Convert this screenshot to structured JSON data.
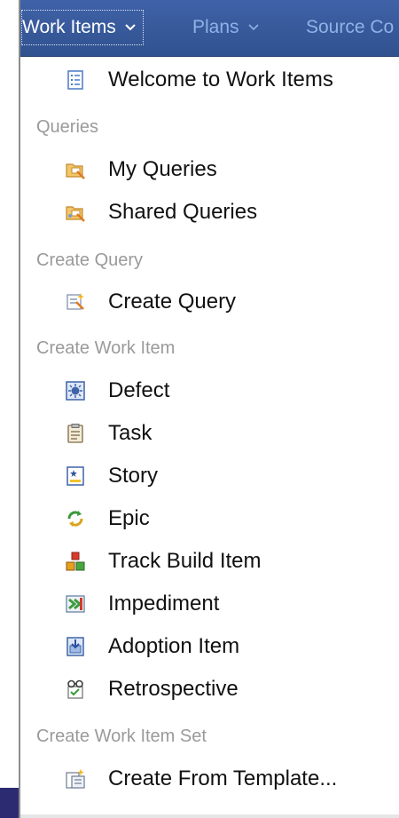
{
  "nav": {
    "tabs": [
      {
        "label": "Work Items",
        "active": true
      },
      {
        "label": "Plans",
        "active": false
      },
      {
        "label": "Source Co",
        "active": false
      }
    ]
  },
  "menu": {
    "welcome": "Welcome to Work Items",
    "sections": [
      {
        "title": "Queries",
        "items": [
          "My Queries",
          "Shared Queries"
        ]
      },
      {
        "title": "Create Query",
        "items": [
          "Create Query"
        ]
      },
      {
        "title": "Create Work Item",
        "items": [
          "Defect",
          "Task",
          "Story",
          "Epic",
          "Track Build Item",
          "Impediment",
          "Adoption Item",
          "Retrospective"
        ]
      },
      {
        "title": "Create Work Item Set",
        "items": [
          "Create From Template..."
        ]
      }
    ]
  },
  "colors": {
    "nav_bg": "#3a5b9e",
    "nav_inactive_text": "#8fb2e6",
    "section_text": "#9a9a9a",
    "item_text": "#111111"
  },
  "icons": {
    "welcome": "document-list-icon",
    "my_queries": "query-folder-icon",
    "shared_queries": "shared-query-folder-icon",
    "create_query": "create-query-icon",
    "defect": "defect-bug-icon",
    "task": "task-clipboard-icon",
    "story": "story-card-icon",
    "epic": "epic-cycle-icon",
    "track_build_item": "build-blocks-icon",
    "impediment": "impediment-icon",
    "adoption_item": "adoption-item-icon",
    "retrospective": "retrospective-glasses-icon",
    "create_from_template": "template-icon"
  }
}
